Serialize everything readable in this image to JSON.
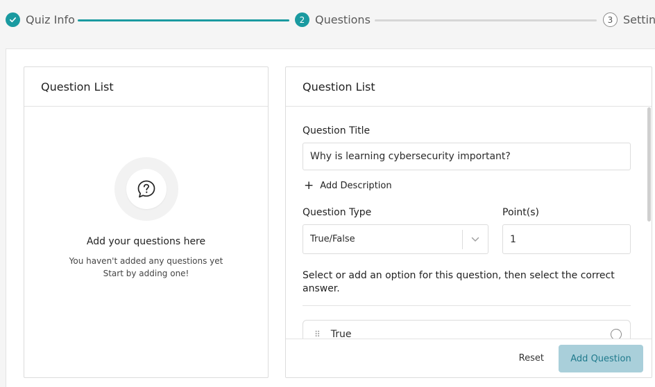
{
  "stepper": {
    "steps": [
      {
        "label": "Quiz Info",
        "state": "done"
      },
      {
        "label": "Questions",
        "number": "2",
        "state": "active"
      },
      {
        "label": "Settings",
        "number": "3",
        "state": "pending"
      }
    ]
  },
  "left_panel": {
    "title": "Question List",
    "empty_icon": "question-chat-icon",
    "empty_title": "Add your questions here",
    "empty_line1": "You haven't added any questions yet",
    "empty_line2": "Start by adding one!"
  },
  "right_panel": {
    "title": "Question List",
    "question_title_label": "Question Title",
    "question_title_value": "Why is learning cybersecurity important?",
    "add_description_label": "Add Description",
    "question_type_label": "Question Type",
    "question_type_value": "True/False",
    "points_label": "Point(s)",
    "points_value": "1",
    "instruction": "Select or add an option for this question, then select the correct answer.",
    "options": [
      {
        "label": "True"
      }
    ],
    "reset_label": "Reset",
    "add_question_label": "Add Question"
  },
  "colors": {
    "accent": "#1a9aa0",
    "add_button_bg": "#a9cfda",
    "add_button_text": "#1f7a8c"
  }
}
